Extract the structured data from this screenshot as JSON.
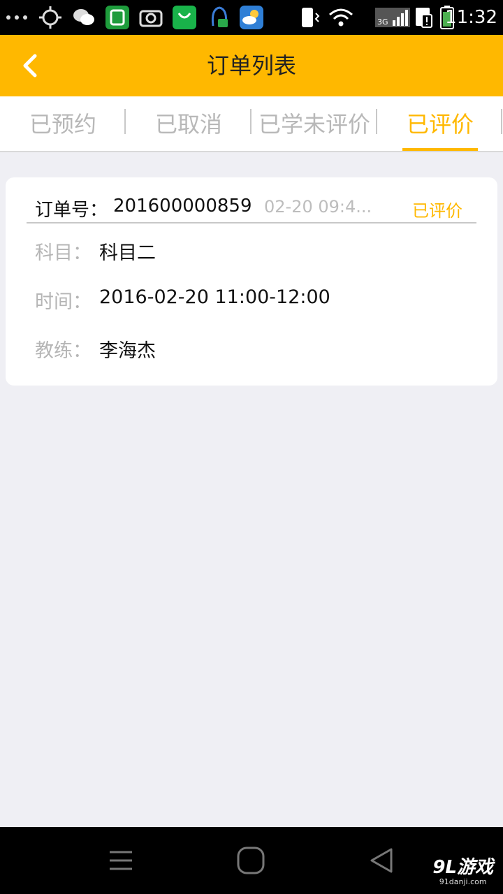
{
  "status_bar": {
    "time": "11:32",
    "network_label": "3G",
    "icons": [
      "more-dots-icon",
      "locate-icon",
      "wechat-icon",
      "security-app-icon",
      "camera-app-icon",
      "store-app-icon",
      "qq-icon",
      "weather-app-icon",
      "vibrate-icon",
      "wifi-icon",
      "signal-icon",
      "sim-alert-icon",
      "battery-icon"
    ]
  },
  "app_bar": {
    "title": "订单列表",
    "back_icon": "chevron-left-icon"
  },
  "tabs": [
    {
      "label": "已预约",
      "active": false
    },
    {
      "label": "已取消",
      "active": false
    },
    {
      "label": "已学未评价",
      "active": false
    },
    {
      "label": "已评价",
      "active": true
    }
  ],
  "order": {
    "number_label": "订单号：",
    "number": "201600000859",
    "time": "02-20 09:4...",
    "status": "已评价",
    "rows": [
      {
        "label": "科目：",
        "value": "科目二"
      },
      {
        "label": "时间：",
        "value": "2016-02-20 11:00-12:00"
      },
      {
        "label": "教练：",
        "value": "李海杰"
      }
    ]
  },
  "nav_bar": {
    "icons": [
      "menu-icon",
      "home-icon",
      "back-icon"
    ]
  },
  "watermark": {
    "title": "9L游戏",
    "subtitle": "91danji.com"
  },
  "colors": {
    "accent": "#ffb800",
    "background": "#efeff4"
  }
}
